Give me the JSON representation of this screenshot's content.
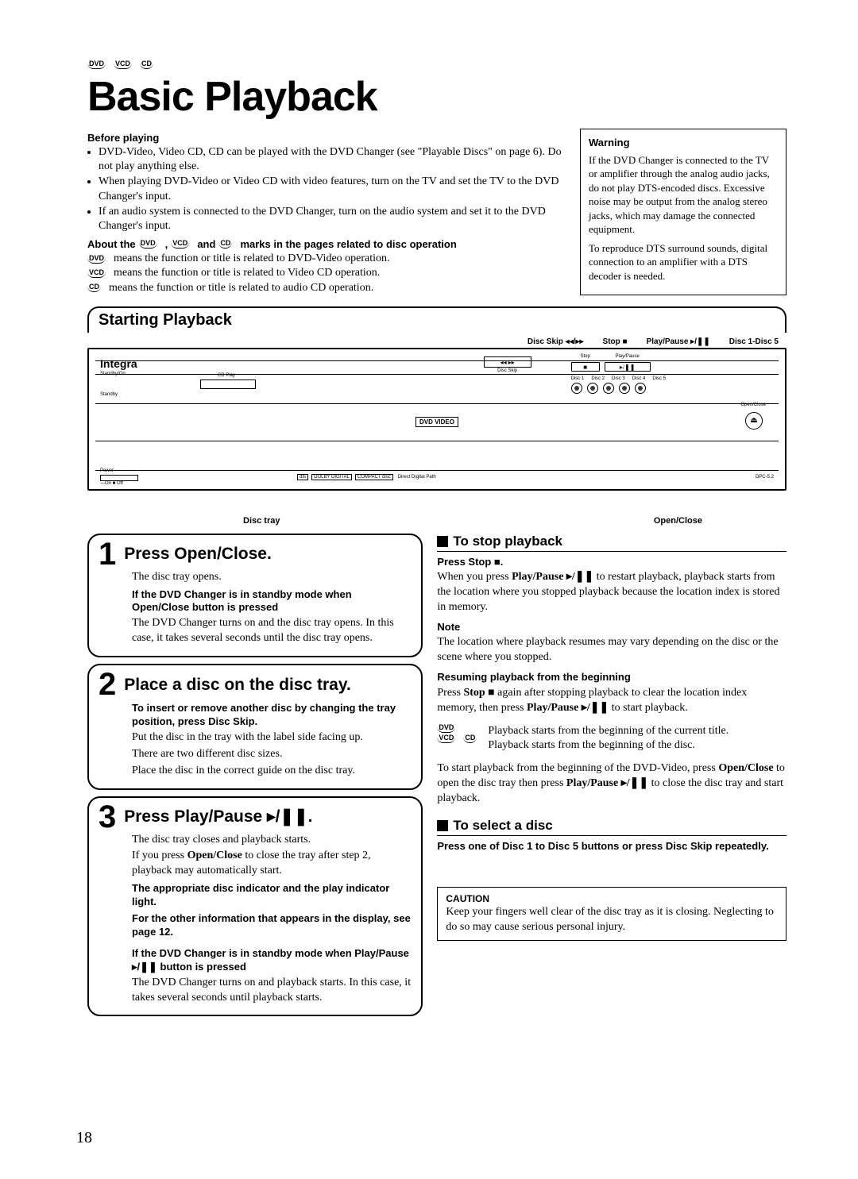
{
  "badges": {
    "dvd": "DVD",
    "vcd": "VCD",
    "cd": "CD"
  },
  "title": "Basic Playback",
  "before": {
    "heading": "Before playing",
    "items": [
      "DVD-Video, Video CD, CD can be played with the DVD Changer (see \"Playable Discs\" on page 6). Do not play anything else.",
      "When playing DVD-Video or Video CD with video features, turn on the TV and set the TV to the DVD Changer's input.",
      "If an audio system is connected to the DVD Changer, turn on the audio system and set it to the DVD Changer's input."
    ]
  },
  "about": {
    "pre": "About the ",
    "mid": ", ",
    "mid2": " and ",
    "post": " marks in the pages related to disc operation",
    "lines": {
      "dvd": " means the function or title is related to DVD-Video operation.",
      "vcd": " means the function or title is related to Video CD operation.",
      "cd": " means the function or title is related to audio CD operation."
    }
  },
  "warning": {
    "heading": "Warning",
    "p1": "If the DVD Changer is connected to the TV or amplifier through the analog audio jacks, do not play DTS-encoded discs. Excessive noise may be output from the analog stereo jacks, which may damage the connected equipment.",
    "p2": "To reproduce DTS surround sounds, digital connection to an amplifier with a DTS decoder is needed."
  },
  "section": "Starting Playback",
  "callouts": {
    "disc_skip": "Disc Skip ◂◂/▸▸",
    "stop": "Stop ■",
    "play_pause": "Play/Pause ▸/❚❚",
    "discs": "Disc 1-Disc 5",
    "disc_tray": "Disc tray",
    "open_close": "Open/Close"
  },
  "device": {
    "brand": "Integra",
    "standby_label": "Standby/On",
    "cd_play": "CD Play",
    "standby": "Standby",
    "stop_lbl": "Stop",
    "play_lbl": "Play/Pause",
    "disc_skip_lbl": "Disc Skip",
    "disc1": "Disc 1",
    "disc2": "Disc 2",
    "disc3": "Disc 3",
    "disc4": "Disc 4",
    "disc5": "Disc 5",
    "open_close": "Open/Close",
    "dvd": "DVD VIDEO",
    "power": "Power",
    "onoff": "—On   ■ Off",
    "dts": "dts",
    "dolby": "DOLBY DIGITAL",
    "cdlogo": "COMPACT disc",
    "ddp": "Direct Digital Path",
    "model": "DPC-5.2"
  },
  "steps": [
    {
      "num": "1",
      "title": "Press Open/Close.",
      "body": [
        {
          "t": "p",
          "text": "The disc tray opens."
        },
        {
          "t": "sh",
          "text": "If the DVD Changer is in standby mode when Open/Close button is pressed"
        },
        {
          "t": "p",
          "text": "The DVD Changer turns on and the disc tray opens. In this case, it takes several seconds until the disc tray opens."
        }
      ]
    },
    {
      "num": "2",
      "title": "Place a disc on the disc tray.",
      "body": [
        {
          "t": "sh",
          "text": "To insert or remove another disc by changing the tray position, press Disc Skip."
        },
        {
          "t": "p",
          "text": "Put the disc in the tray with the label side facing up."
        },
        {
          "t": "p",
          "text": "There are two different disc sizes."
        },
        {
          "t": "p",
          "text": "Place the disc in the correct guide on the disc tray."
        }
      ]
    },
    {
      "num": "3",
      "title": "Press Play/Pause ▸/❚❚.",
      "body": [
        {
          "t": "p",
          "text": "The disc tray closes and playback starts."
        },
        {
          "t": "p_html",
          "pre": "If you press ",
          "b": "Open/Close",
          "post": " to close the tray after step 2, playback may automatically start."
        },
        {
          "t": "sh",
          "text": "The appropriate disc indicator and the play indicator light."
        },
        {
          "t": "sh",
          "text": "For the other information that appears in the display, see page 12."
        },
        {
          "t": "sh",
          "text": "If the DVD Changer is in standby mode when Play/Pause ▸/❚❚ button is pressed"
        },
        {
          "t": "p",
          "text": "The DVD Changer turns on and playback starts. In this case, it takes several seconds until playback starts."
        }
      ]
    }
  ],
  "stop_playback": {
    "heading": "To stop playback",
    "press_stop": "Press Stop ■.",
    "p1_pre": "When you press ",
    "p1_b": "Play/Pause ▸/❚❚",
    "p1_post": " to restart playback, playback starts from the location where you stopped playback because the location index is stored in memory.",
    "note_h": "Note",
    "note": "The location where playback resumes may vary depending on the disc or the scene where you stopped.",
    "resume_h": "Resuming playback from the beginning",
    "resume_pre": "Press ",
    "resume_b1": "Stop ■",
    "resume_mid": " again after stopping playback to clear the location index memory, then press ",
    "resume_b2": "Play/Pause ▸/❚❚",
    "resume_post": " to start playback.",
    "dvd_note": "Playback starts from the beginning of the current title.",
    "vcdcd_note": "Playback starts from the beginning of the disc.",
    "start_begin_pre": "To start playback from the beginning of the DVD-Video, press ",
    "start_begin_b1": "Open/Close",
    "start_begin_mid": " to open the disc tray then press ",
    "start_begin_b2": "Play/Pause ▸/❚❚",
    "start_begin_post": " to close the disc tray and start playback."
  },
  "select_disc": {
    "heading": "To select a disc",
    "text": "Press one of Disc 1 to Disc 5 buttons or press Disc Skip repeatedly."
  },
  "caution": {
    "heading": "CAUTION",
    "text": "Keep your fingers well clear of the disc tray as it is closing. Neglecting to do so may cause serious personal injury."
  },
  "page_number": "18"
}
